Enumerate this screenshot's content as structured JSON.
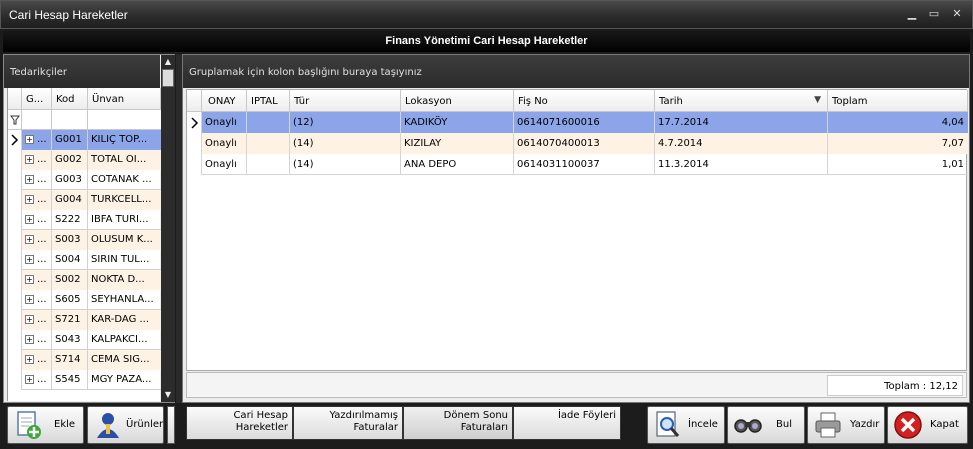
{
  "window": {
    "title": "Cari Hesap Hareketler",
    "min": "▁",
    "max": "▭",
    "close": "✕"
  },
  "header": {
    "title": "Finans Yönetimi Cari Hesap Hareketler"
  },
  "left": {
    "title": "Tedarikçiler",
    "columns": [
      "G...",
      "Kod",
      "Ünvan"
    ],
    "rows": [
      {
        "g": "...",
        "kod": "G001",
        "unvan": "KILIÇ TOP..."
      },
      {
        "g": "...",
        "kod": "G002",
        "unvan": "TOTAL OI..."
      },
      {
        "g": "...",
        "kod": "G003",
        "unvan": "COTANAK ..."
      },
      {
        "g": "...",
        "kod": "G004",
        "unvan": "TURKCELL..."
      },
      {
        "g": "...",
        "kod": "S222",
        "unvan": "IBFA TURI..."
      },
      {
        "g": "...",
        "kod": "S003",
        "unvan": "OLUSUM K..."
      },
      {
        "g": "...",
        "kod": "S004",
        "unvan": "SIRIN TUL..."
      },
      {
        "g": "...",
        "kod": "S002",
        "unvan": "NOKTA D..."
      },
      {
        "g": "...",
        "kod": "S605",
        "unvan": "SEYHANLA..."
      },
      {
        "g": "...",
        "kod": "S721",
        "unvan": "KAR-DAG ..."
      },
      {
        "g": "...",
        "kod": "S043",
        "unvan": "KALPAKCI..."
      },
      {
        "g": "...",
        "kod": "S714",
        "unvan": "CEMA SIG..."
      },
      {
        "g": "...",
        "kod": "S545",
        "unvan": "MGY PAZA..."
      }
    ]
  },
  "right": {
    "group_hint": "Gruplamak için kolon başlığını buraya taşıyınız",
    "columns": [
      "ONAY",
      "IPTAL",
      "Tür",
      "Lokasyon",
      "Fiş No",
      "Tarih",
      "Toplam"
    ],
    "rows": [
      {
        "onay": "Onaylı",
        "iptal": "",
        "tur": "(12)",
        "lokasyon": "KADIKÖY",
        "fisno": "0614071600016",
        "tarih": "17.7.2014",
        "toplam": "4,04"
      },
      {
        "onay": "Onaylı",
        "iptal": "",
        "tur": "(14)",
        "lokasyon": "KIZILAY",
        "fisno": "0614070400013",
        "tarih": "4.7.2014",
        "toplam": "7,07"
      },
      {
        "onay": "Onaylı",
        "iptal": "",
        "tur": "(14)",
        "lokasyon": "ANA DEPO",
        "fisno": "0614031100037",
        "tarih": "11.3.2014",
        "toplam": "1,01"
      }
    ],
    "total": "Toplam : 12,12"
  },
  "buttons": {
    "ekle": "Ekle",
    "urunler": "Ürünler",
    "incele": "İncele",
    "bul": "Bul",
    "yazdir": "Yazdır",
    "kapat": "Kapat"
  },
  "tabs": [
    {
      "l1": "Cari Hesap",
      "l2": "Hareketler"
    },
    {
      "l1": "Yazdırılmamış",
      "l2": "Faturalar"
    },
    {
      "l1": "Dönem Sonu",
      "l2": "Faturaları"
    },
    {
      "l1": "İade Föyleri",
      "l2": ""
    }
  ]
}
